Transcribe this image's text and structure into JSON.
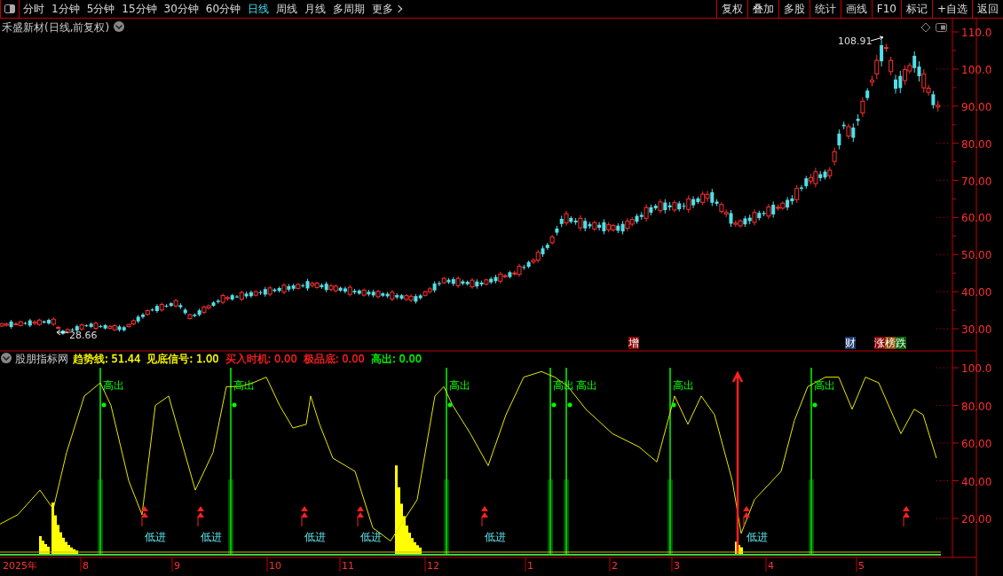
{
  "toolbar": {
    "periods": [
      {
        "label": "分时",
        "selected": false
      },
      {
        "label": "1分钟",
        "selected": false
      },
      {
        "label": "5分钟",
        "selected": false
      },
      {
        "label": "15分钟",
        "selected": false
      },
      {
        "label": "30分钟",
        "selected": false
      },
      {
        "label": "60分钟",
        "selected": false
      },
      {
        "label": "日线",
        "selected": true
      },
      {
        "label": "周线",
        "selected": false
      },
      {
        "label": "月线",
        "selected": false
      },
      {
        "label": "多周期",
        "selected": false
      }
    ],
    "more": "更多",
    "buttons": [
      "复权",
      "叠加",
      "多股",
      "统计",
      "画线",
      "F10",
      "标记",
      "+自选",
      "返回"
    ]
  },
  "price_panel": {
    "title": "禾盛新材(日线,前复权)",
    "axis_labels": [
      "110.0",
      "100.0",
      "90.00",
      "80.00",
      "70.00",
      "60.00",
      "50.00",
      "40.00",
      "30.00"
    ],
    "high_label": "108.91",
    "low_label": "28.66",
    "event_tags": [
      {
        "label": "增",
        "color": "#8b0000"
      },
      {
        "label": "财",
        "color": "#1e3a6e"
      },
      {
        "label": "涨",
        "color": "#8b0000"
      },
      {
        "label": "榜",
        "color": "#8b4a00"
      },
      {
        "label": "跌",
        "color": "#006400"
      }
    ]
  },
  "indicator_panel": {
    "name": "股朋指标网",
    "legend": [
      {
        "text": "趋势线: 51.44",
        "color": "#ffff00"
      },
      {
        "text": "见底信号: 1.00",
        "color": "#ffff00"
      },
      {
        "text": "买入时机: 0.00",
        "color": "#ff2020"
      },
      {
        "text": "极品底: 0.00",
        "color": "#ff2020"
      },
      {
        "text": "高出: 0.00",
        "color": "#00ff00"
      }
    ],
    "axis_labels": [
      "100.0",
      "80.00",
      "60.00",
      "40.00",
      "20.00"
    ],
    "sell_signals": [
      "高出",
      "高出",
      "高出",
      "高出",
      "高出",
      "高出",
      "高出"
    ],
    "buy_signals": [
      "低进",
      "低进",
      "低进",
      "低进",
      "低进",
      "低进"
    ]
  },
  "time_axis": [
    "2025年",
    "8",
    "9",
    "10",
    "11",
    "12",
    "1",
    "2",
    "3",
    "4",
    "5"
  ]
}
